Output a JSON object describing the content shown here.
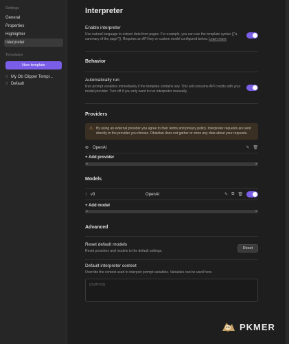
{
  "sidebar": {
    "settings_heading": "Settings",
    "items": [
      {
        "label": "General"
      },
      {
        "label": "Properties"
      },
      {
        "label": "Highlighter"
      },
      {
        "label": "Interpreter"
      }
    ],
    "templates_heading": "Templates",
    "new_template_label": "New template",
    "templates": [
      {
        "label": "My Ob Clipper Templ..."
      },
      {
        "label": "Default"
      }
    ]
  },
  "main": {
    "title": "Interpreter",
    "enable": {
      "name": "Enable interpreter",
      "desc": "Use natural language to extract data from pages. For example, you can use the template syntax {{\"a summary of the page\"}}. Requires an API key or custom model configured below.",
      "learn_more": "Learn more",
      "enabled": true
    },
    "behavior": {
      "title": "Behavior",
      "auto_run_name": "Automatically run",
      "auto_run_desc": "Run prompt variables immediately if the template contains any. This will consume API credits with your model provider. Turn off if you only want to run interpreter manually.",
      "auto_run_enabled": true
    },
    "providers": {
      "title": "Providers",
      "warning": "By using an external provider you agree to their terms and privacy policy. Interpreter requests are sent directly to the provider you choose. Obsidian does not gather or store any data about your requests.",
      "list": [
        {
          "name": "OpenAI"
        }
      ],
      "add_label": "+ Add provider"
    },
    "models": {
      "title": "Models",
      "list": [
        {
          "name": "v3",
          "provider": "OpenAI",
          "enabled": true
        }
      ],
      "add_label": "+ Add model"
    },
    "advanced": {
      "title": "Advanced",
      "reset_name": "Reset default models",
      "reset_desc": "Reset providers and models to the default settings.",
      "reset_button": "Reset",
      "context_name": "Default interpreter context",
      "context_desc": "Override the context used to interpret prompt variables. Variables can be used here.",
      "context_placeholder": "{{fullHtml}}"
    }
  },
  "watermark": {
    "text": "PKMER"
  },
  "colors": {
    "accent": "#7b5ee8",
    "warning_bg": "#3a2f23",
    "warning_icon": "#e2a14a"
  }
}
